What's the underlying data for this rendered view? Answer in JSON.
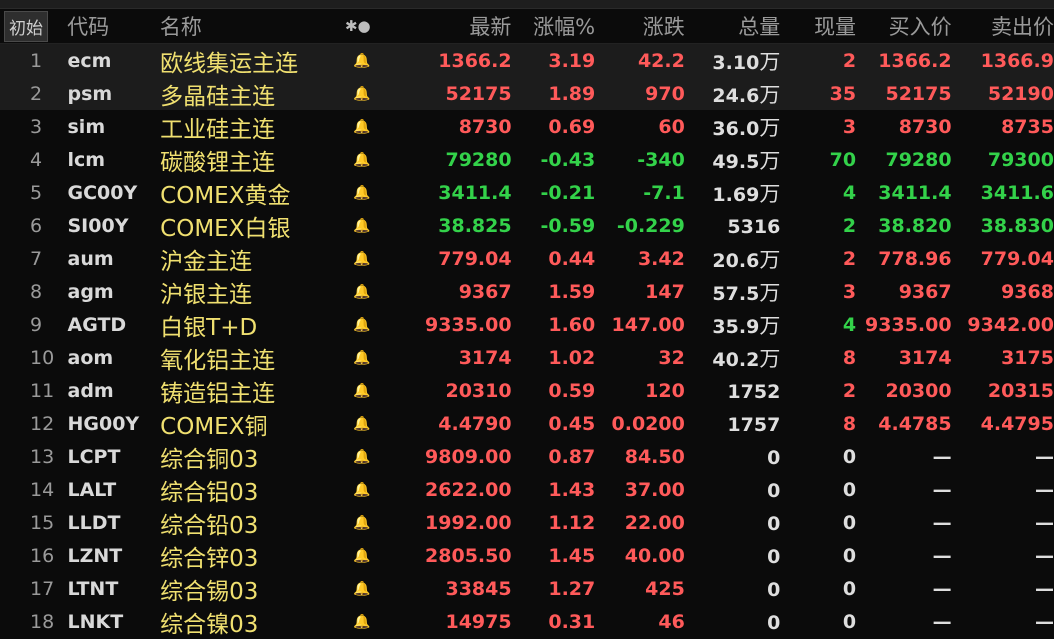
{
  "header": {
    "init_label": "初始",
    "code": "代码",
    "name": "名称",
    "marker": "✱●",
    "last": "最新",
    "pct": "涨幅%",
    "chg": "涨跌",
    "vol": "总量",
    "cur": "现量",
    "bid": "买入价",
    "ask": "卖出价"
  },
  "rows": [
    {
      "idx": "1",
      "code": "ecm",
      "name": "欧线集运主连",
      "last": "1366.2",
      "pct": "3.19",
      "chg": "42.2",
      "vol": "3.10",
      "vol_unit": "万",
      "cur": "2",
      "bid": "1366.2",
      "ask": "1366.9",
      "dir": "up",
      "selected": true,
      "alert": false
    },
    {
      "idx": "2",
      "code": "psm",
      "name": "多晶硅主连",
      "last": "52175",
      "pct": "1.89",
      "chg": "970",
      "vol": "24.6",
      "vol_unit": "万",
      "cur": "35",
      "bid": "52175",
      "ask": "52190",
      "dir": "up",
      "selected": true,
      "alert": false
    },
    {
      "idx": "3",
      "code": "sim",
      "name": "工业硅主连",
      "last": "8730",
      "pct": "0.69",
      "chg": "60",
      "vol": "36.0",
      "vol_unit": "万",
      "cur": "3",
      "bid": "8730",
      "ask": "8735",
      "dir": "up",
      "selected": false,
      "alert": false
    },
    {
      "idx": "4",
      "code": "lcm",
      "name": "碳酸锂主连",
      "last": "79280",
      "pct": "-0.43",
      "chg": "-340",
      "vol": "49.5",
      "vol_unit": "万",
      "cur": "70",
      "bid": "79280",
      "ask": "79300",
      "dir": "down",
      "selected": false,
      "alert": true
    },
    {
      "idx": "5",
      "code": "GC00Y",
      "name": "COMEX黄金",
      "last": "3411.4",
      "pct": "-0.21",
      "chg": "-7.1",
      "vol": "1.69",
      "vol_unit": "万",
      "cur": "4",
      "bid": "3411.4",
      "ask": "3411.6",
      "dir": "down",
      "selected": false,
      "alert": false
    },
    {
      "idx": "6",
      "code": "SI00Y",
      "name": "COMEX白银",
      "last": "38.825",
      "pct": "-0.59",
      "chg": "-0.229",
      "vol": "5316",
      "vol_unit": "",
      "cur": "2",
      "bid": "38.820",
      "ask": "38.830",
      "dir": "down",
      "selected": false,
      "alert": false
    },
    {
      "idx": "7",
      "code": "aum",
      "name": "沪金主连",
      "last": "779.04",
      "pct": "0.44",
      "chg": "3.42",
      "vol": "20.6",
      "vol_unit": "万",
      "cur": "2",
      "bid": "778.96",
      "ask": "779.04",
      "dir": "up",
      "selected": false,
      "alert": false
    },
    {
      "idx": "8",
      "code": "agm",
      "name": "沪银主连",
      "last": "9367",
      "pct": "1.59",
      "chg": "147",
      "vol": "57.5",
      "vol_unit": "万",
      "cur": "3",
      "bid": "9367",
      "ask": "9368",
      "dir": "up",
      "selected": false,
      "alert": false
    },
    {
      "idx": "9",
      "code": "AGTD",
      "name": "白银T+D",
      "last": "9335.00",
      "pct": "1.60",
      "chg": "147.00",
      "vol": "35.9",
      "vol_unit": "万",
      "cur": "4",
      "bid": "9335.00",
      "ask": "9342.00",
      "dir": "up",
      "cur_dir": "down",
      "selected": false,
      "alert": false
    },
    {
      "idx": "10",
      "code": "aom",
      "name": "氧化铝主连",
      "last": "3174",
      "pct": "1.02",
      "chg": "32",
      "vol": "40.2",
      "vol_unit": "万",
      "cur": "8",
      "bid": "3174",
      "ask": "3175",
      "dir": "up",
      "selected": false,
      "alert": false
    },
    {
      "idx": "11",
      "code": "adm",
      "name": "铸造铝主连",
      "last": "20310",
      "pct": "0.59",
      "chg": "120",
      "vol": "1752",
      "vol_unit": "",
      "cur": "2",
      "bid": "20300",
      "ask": "20315",
      "dir": "up",
      "selected": false,
      "alert": false
    },
    {
      "idx": "12",
      "code": "HG00Y",
      "name": "COMEX铜",
      "last": "4.4790",
      "pct": "0.45",
      "chg": "0.0200",
      "vol": "1757",
      "vol_unit": "",
      "cur": "8",
      "bid": "4.4785",
      "ask": "4.4795",
      "dir": "up",
      "selected": false,
      "alert": false
    },
    {
      "idx": "13",
      "code": "LCPT",
      "name": "综合铜03",
      "last": "9809.00",
      "pct": "0.87",
      "chg": "84.50",
      "vol": "0",
      "vol_unit": "",
      "cur": "0",
      "bid": "—",
      "ask": "—",
      "dir": "up",
      "selected": false,
      "alert": false
    },
    {
      "idx": "14",
      "code": "LALT",
      "name": "综合铝03",
      "last": "2622.00",
      "pct": "1.43",
      "chg": "37.00",
      "vol": "0",
      "vol_unit": "",
      "cur": "0",
      "bid": "—",
      "ask": "—",
      "dir": "up",
      "selected": false,
      "alert": false
    },
    {
      "idx": "15",
      "code": "LLDT",
      "name": "综合铅03",
      "last": "1992.00",
      "pct": "1.12",
      "chg": "22.00",
      "vol": "0",
      "vol_unit": "",
      "cur": "0",
      "bid": "—",
      "ask": "—",
      "dir": "up",
      "selected": false,
      "alert": false
    },
    {
      "idx": "16",
      "code": "LZNT",
      "name": "综合锌03",
      "last": "2805.50",
      "pct": "1.45",
      "chg": "40.00",
      "vol": "0",
      "vol_unit": "",
      "cur": "0",
      "bid": "—",
      "ask": "—",
      "dir": "up",
      "selected": false,
      "alert": false
    },
    {
      "idx": "17",
      "code": "LTNT",
      "name": "综合锡03",
      "last": "33845",
      "pct": "1.27",
      "chg": "425",
      "vol": "0",
      "vol_unit": "",
      "cur": "0",
      "bid": "—",
      "ask": "—",
      "dir": "up",
      "selected": false,
      "alert": false
    },
    {
      "idx": "18",
      "code": "LNKT",
      "name": "综合镍03",
      "last": "14975",
      "pct": "0.31",
      "chg": "46",
      "vol": "0",
      "vol_unit": "",
      "cur": "0",
      "bid": "—",
      "ask": "—",
      "dir": "up",
      "cur_dir": "down",
      "selected": false,
      "alert": false
    }
  ],
  "icons": {
    "bell": "bell-icon",
    "marker": "asterisk-dot-icon"
  },
  "colors": {
    "up": "#ff5a5a",
    "down": "#33d24a",
    "name": "#f0e070",
    "alert": "#ff4a3a"
  }
}
